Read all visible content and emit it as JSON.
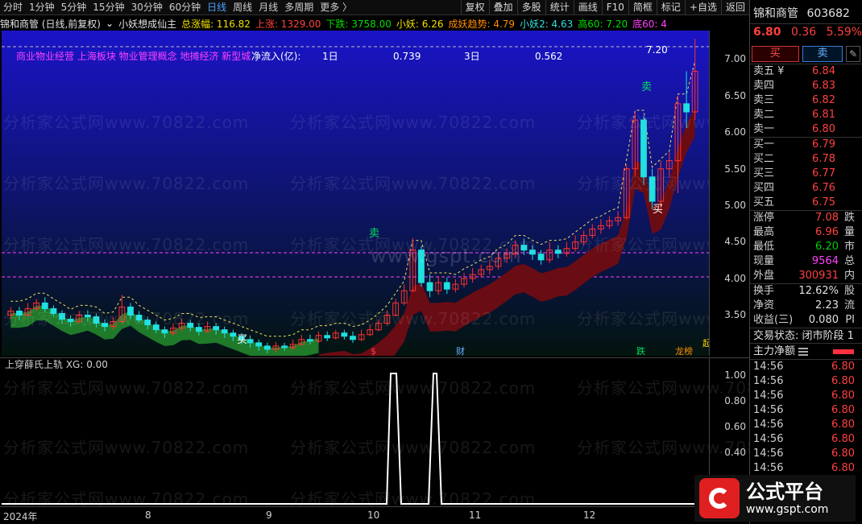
{
  "toolbar": {
    "periods": [
      "分时",
      "1分钟",
      "5分钟",
      "15分钟",
      "30分钟",
      "60分钟",
      "日线",
      "周线",
      "月线",
      "多周期",
      "更多 〉"
    ],
    "active_period": "日线",
    "tools": [
      "复权",
      "叠加",
      "多股",
      "统计",
      "画线",
      "F10",
      "简框",
      "标记",
      "+自选",
      "返回"
    ]
  },
  "legend": {
    "stock": "锦和商管 (日线,前复权)",
    "indicator": "小妖想成仙主",
    "items": [
      {
        "label": "总涨幅: 116.82",
        "color": "yellow"
      },
      {
        "label": "上涨: 1329.00",
        "color": "red"
      },
      {
        "label": "下跌: 3758.00",
        "color": "green"
      },
      {
        "label": "小妖: 6.26",
        "color": "yellow"
      },
      {
        "label": "成妖趋势: 4.79",
        "color": "orange"
      },
      {
        "label": "小妖2: 4.63",
        "color": "cyan"
      },
      {
        "label": "高60: 7.20",
        "color": "green"
      },
      {
        "label": "底60: 4",
        "color": "magenta"
      }
    ]
  },
  "concepts": "商业物业经营 上海板块 物业管理概念 地摊经济 新型城",
  "net_inflow": {
    "label": "净流入(亿):",
    "d1_label": "1日",
    "d1_value": "0.739",
    "d3_label": "3日",
    "d3_value": "0.562"
  },
  "price_axis": [
    "7.00",
    "6.50",
    "6.00",
    "5.50",
    "5.00",
    "4.50",
    "4.00",
    "3.50"
  ],
  "price_range": [
    3.3,
    7.3
  ],
  "high_marker": "7.20",
  "chart_markers": {
    "sell": "卖",
    "buy": "买",
    "events": [
      "$",
      "财",
      "跌",
      "龙榜",
      "起"
    ]
  },
  "sub_chart": {
    "title": "上穿薛氏上轨  XG: 0.00",
    "axis": [
      "1.00",
      "0.80",
      "0.60",
      "0.40"
    ]
  },
  "x_axis": [
    "2024年",
    "8",
    "9",
    "10",
    "11",
    "12"
  ],
  "watermark": "分析家公式网www.70822.com",
  "watermark2": "www.gspt.com",
  "chart_data": {
    "type": "candlestick",
    "title": "锦和商管 (日线,前复权)",
    "x": [
      "2024年",
      "8",
      "9",
      "10",
      "11",
      "12"
    ],
    "ylim": [
      3.3,
      7.3
    ],
    "high_label": 7.2,
    "candles": [
      [
        3.8,
        3.85,
        3.75,
        3.9
      ],
      [
        3.85,
        3.8,
        3.74,
        3.9
      ],
      [
        3.8,
        3.88,
        3.78,
        3.95
      ],
      [
        3.88,
        3.95,
        3.85,
        4.0
      ],
      [
        3.95,
        3.88,
        3.84,
        4.02
      ],
      [
        3.88,
        3.82,
        3.78,
        3.92
      ],
      [
        3.82,
        3.75,
        3.7,
        3.86
      ],
      [
        3.75,
        3.72,
        3.66,
        3.8
      ],
      [
        3.72,
        3.8,
        3.7,
        3.85
      ],
      [
        3.8,
        3.78,
        3.72,
        3.86
      ],
      [
        3.78,
        3.7,
        3.65,
        3.82
      ],
      [
        3.7,
        3.66,
        3.6,
        3.75
      ],
      [
        3.66,
        3.72,
        3.62,
        3.78
      ],
      [
        3.72,
        3.9,
        3.7,
        4.05
      ],
      [
        3.9,
        3.8,
        3.75,
        3.95
      ],
      [
        3.8,
        3.74,
        3.7,
        3.85
      ],
      [
        3.74,
        3.68,
        3.62,
        3.78
      ],
      [
        3.68,
        3.62,
        3.58,
        3.72
      ],
      [
        3.62,
        3.58,
        3.52,
        3.66
      ],
      [
        3.58,
        3.64,
        3.55,
        3.7
      ],
      [
        3.64,
        3.7,
        3.6,
        3.76
      ],
      [
        3.7,
        3.65,
        3.6,
        3.74
      ],
      [
        3.65,
        3.6,
        3.55,
        3.7
      ],
      [
        3.6,
        3.66,
        3.58,
        3.72
      ],
      [
        3.66,
        3.62,
        3.56,
        3.7
      ],
      [
        3.62,
        3.58,
        3.52,
        3.66
      ],
      [
        3.58,
        3.54,
        3.48,
        3.62
      ],
      [
        3.54,
        3.5,
        3.44,
        3.58
      ],
      [
        3.5,
        3.46,
        3.4,
        3.55
      ],
      [
        3.46,
        3.42,
        3.36,
        3.5
      ],
      [
        3.42,
        3.38,
        3.33,
        3.46
      ],
      [
        3.38,
        3.42,
        3.34,
        3.47
      ],
      [
        3.42,
        3.4,
        3.36,
        3.46
      ],
      [
        3.4,
        3.44,
        3.37,
        3.5
      ],
      [
        3.44,
        3.5,
        3.42,
        3.56
      ],
      [
        3.5,
        3.48,
        3.44,
        3.56
      ],
      [
        3.48,
        3.55,
        3.46,
        3.6
      ],
      [
        3.55,
        3.52,
        3.48,
        3.6
      ],
      [
        3.52,
        3.58,
        3.5,
        3.62
      ],
      [
        3.58,
        3.54,
        3.5,
        3.62
      ],
      [
        3.54,
        3.5,
        3.46,
        3.6
      ],
      [
        3.5,
        3.56,
        3.48,
        3.62
      ],
      [
        3.56,
        3.62,
        3.54,
        3.68
      ],
      [
        3.62,
        3.7,
        3.6,
        3.75
      ],
      [
        3.7,
        3.8,
        3.68,
        3.86
      ],
      [
        3.8,
        3.95,
        3.78,
        4.0
      ],
      [
        3.95,
        4.1,
        3.92,
        4.18
      ],
      [
        4.1,
        4.6,
        4.08,
        4.75
      ],
      [
        4.6,
        4.2,
        4.15,
        4.65
      ],
      [
        4.2,
        4.1,
        4.02,
        4.3
      ],
      [
        4.1,
        4.2,
        4.05,
        4.28
      ],
      [
        4.2,
        4.12,
        4.06,
        4.26
      ],
      [
        4.12,
        4.18,
        4.08,
        4.24
      ],
      [
        4.18,
        4.25,
        4.14,
        4.32
      ],
      [
        4.25,
        4.3,
        4.2,
        4.38
      ],
      [
        4.3,
        4.36,
        4.26,
        4.42
      ],
      [
        4.36,
        4.4,
        4.3,
        4.48
      ],
      [
        4.4,
        4.5,
        4.36,
        4.56
      ],
      [
        4.5,
        4.55,
        4.44,
        4.62
      ],
      [
        4.55,
        4.66,
        4.5,
        4.72
      ],
      [
        4.66,
        4.6,
        4.54,
        4.74
      ],
      [
        4.6,
        4.55,
        4.48,
        4.66
      ],
      [
        4.55,
        4.48,
        4.42,
        4.6
      ],
      [
        4.48,
        4.6,
        4.44,
        4.7
      ],
      [
        4.6,
        4.56,
        4.5,
        4.66
      ],
      [
        4.56,
        4.62,
        4.52,
        4.7
      ],
      [
        4.62,
        4.7,
        4.58,
        4.78
      ],
      [
        4.7,
        4.78,
        4.66,
        4.84
      ],
      [
        4.78,
        4.86,
        4.74,
        4.92
      ],
      [
        4.86,
        4.9,
        4.8,
        4.98
      ],
      [
        4.9,
        4.96,
        4.86,
        5.02
      ],
      [
        4.96,
        5.0,
        4.9,
        5.08
      ],
      [
        5.0,
        5.6,
        4.98,
        5.65
      ],
      [
        5.6,
        6.2,
        5.5,
        6.3
      ],
      [
        6.2,
        5.5,
        5.4,
        6.25
      ],
      [
        5.5,
        5.2,
        5.1,
        5.6
      ],
      [
        5.2,
        5.6,
        5.1,
        5.7
      ],
      [
        5.6,
        5.7,
        5.5,
        5.8
      ],
      [
        5.7,
        6.4,
        5.3,
        6.5
      ],
      [
        6.4,
        6.3,
        6.1,
        6.8
      ],
      [
        6.3,
        6.8,
        6.2,
        7.2
      ]
    ]
  }
}
